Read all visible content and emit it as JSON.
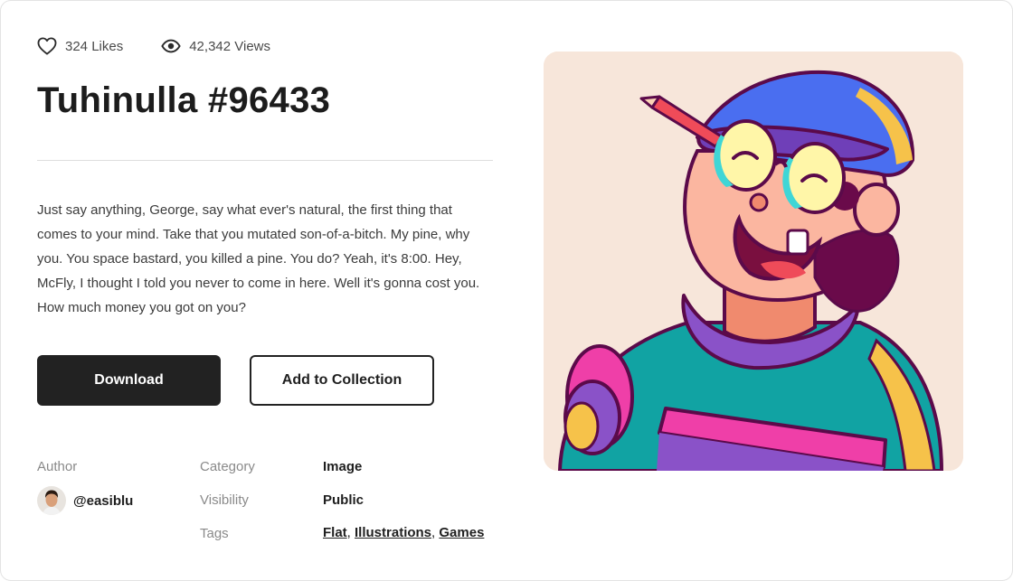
{
  "stats": {
    "likes_icon": "heart-icon",
    "likes_label": "324 Likes",
    "views_icon": "eye-icon",
    "views_label": "42,342 Views"
  },
  "title": "Tuhinulla #96433",
  "description": "Just say anything, George, say what ever's natural, the first thing that comes to your mind. Take that you mutated son-of-a-bitch. My pine, why you. You space bastard, you killed a pine. You do? Yeah, it's 8:00. Hey, McFly, I thought I told you never to come in here. Well it's gonna cost you. How much money you got on you?",
  "actions": {
    "download_label": "Download",
    "collection_label": "Add to Collection"
  },
  "meta": {
    "author_label": "Author",
    "author_handle": "@easiblu",
    "category_label": "Category",
    "category_value": "Image",
    "visibility_label": "Visibility",
    "visibility_value": "Public",
    "tags_label": "Tags",
    "tags": [
      "Flat",
      "Illustrations",
      "Games"
    ]
  },
  "colors": {
    "primary_button": "#222222",
    "art_background": "#f7e6da"
  }
}
